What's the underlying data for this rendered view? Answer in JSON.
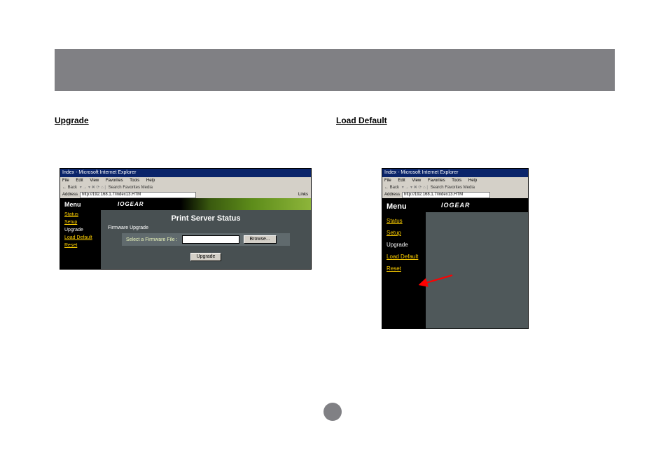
{
  "section_labels": {
    "upgrade": "Upgrade",
    "load_default": "Load Default"
  },
  "ie_window": {
    "title": "Index - Microsoft Internet Explorer",
    "menus": [
      "File",
      "Edit",
      "View",
      "Favorites",
      "Tools",
      "Help"
    ],
    "toolbar_back": "Back",
    "toolbar_search": "Search",
    "toolbar_favorites": "Favorites",
    "toolbar_media": "Media",
    "address_label": "Address",
    "address_value_left": "http://192.168.1.7/index13.HTM",
    "address_value_right": "http://192.168.1.7/index13.HTM",
    "links_label": "Links"
  },
  "sidebar": {
    "heading": "Menu",
    "items": [
      {
        "label": "Status",
        "style": "link-yellow"
      },
      {
        "label": "Setup",
        "style": "link-yellow"
      },
      {
        "label": "Upgrade",
        "style": "link-white"
      },
      {
        "label": "Load Default",
        "style": "link-yellow"
      },
      {
        "label": "Reset",
        "style": "link-yellow"
      }
    ]
  },
  "main_left": {
    "logo": "IOGEAR",
    "page_title": "Print Server Status",
    "firmware_label": "Firmware Upgrade",
    "select_label": "Select a Firmware File :",
    "browse_label": "Browse...",
    "upgrade_button": "Upgrade"
  },
  "main_right": {
    "logo": "IOGEAR"
  },
  "icons": {
    "ie": "ie-icon",
    "back": "back-icon",
    "forward": "forward-icon",
    "stop": "stop-icon",
    "refresh": "refresh-icon",
    "home": "home-icon"
  }
}
